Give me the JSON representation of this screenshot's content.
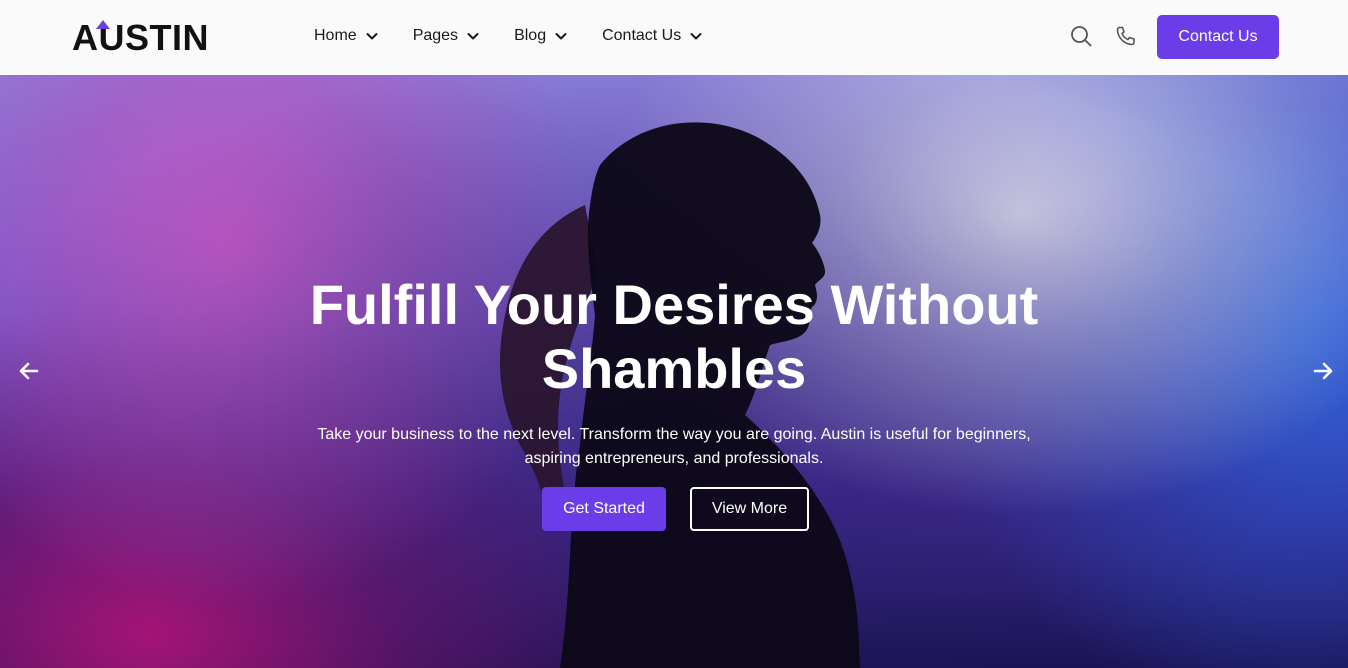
{
  "header": {
    "logo_text": "AUSTIN",
    "nav": [
      {
        "label": "Home"
      },
      {
        "label": "Pages"
      },
      {
        "label": "Blog"
      },
      {
        "label": "Contact Us"
      }
    ],
    "icons": {
      "search": "search-icon",
      "phone": "phone-icon"
    },
    "cta_label": "Contact Us"
  },
  "hero": {
    "title_line1": "Fulfill Your Desires Without",
    "title_line2": "Shambles",
    "subtitle_line1": "Take your business to the next level. Transform the way you are going. Austin is useful for beginners,",
    "subtitle_line2": "aspiring entrepreneurs, and professionals.",
    "primary_label": "Get Started",
    "secondary_label": "View More",
    "prev_icon": "arrow-left-icon",
    "next_icon": "arrow-right-icon"
  },
  "colors": {
    "accent": "#6a3de8",
    "header_bg": "#fafafa",
    "text_dark": "#1a1a1a"
  }
}
